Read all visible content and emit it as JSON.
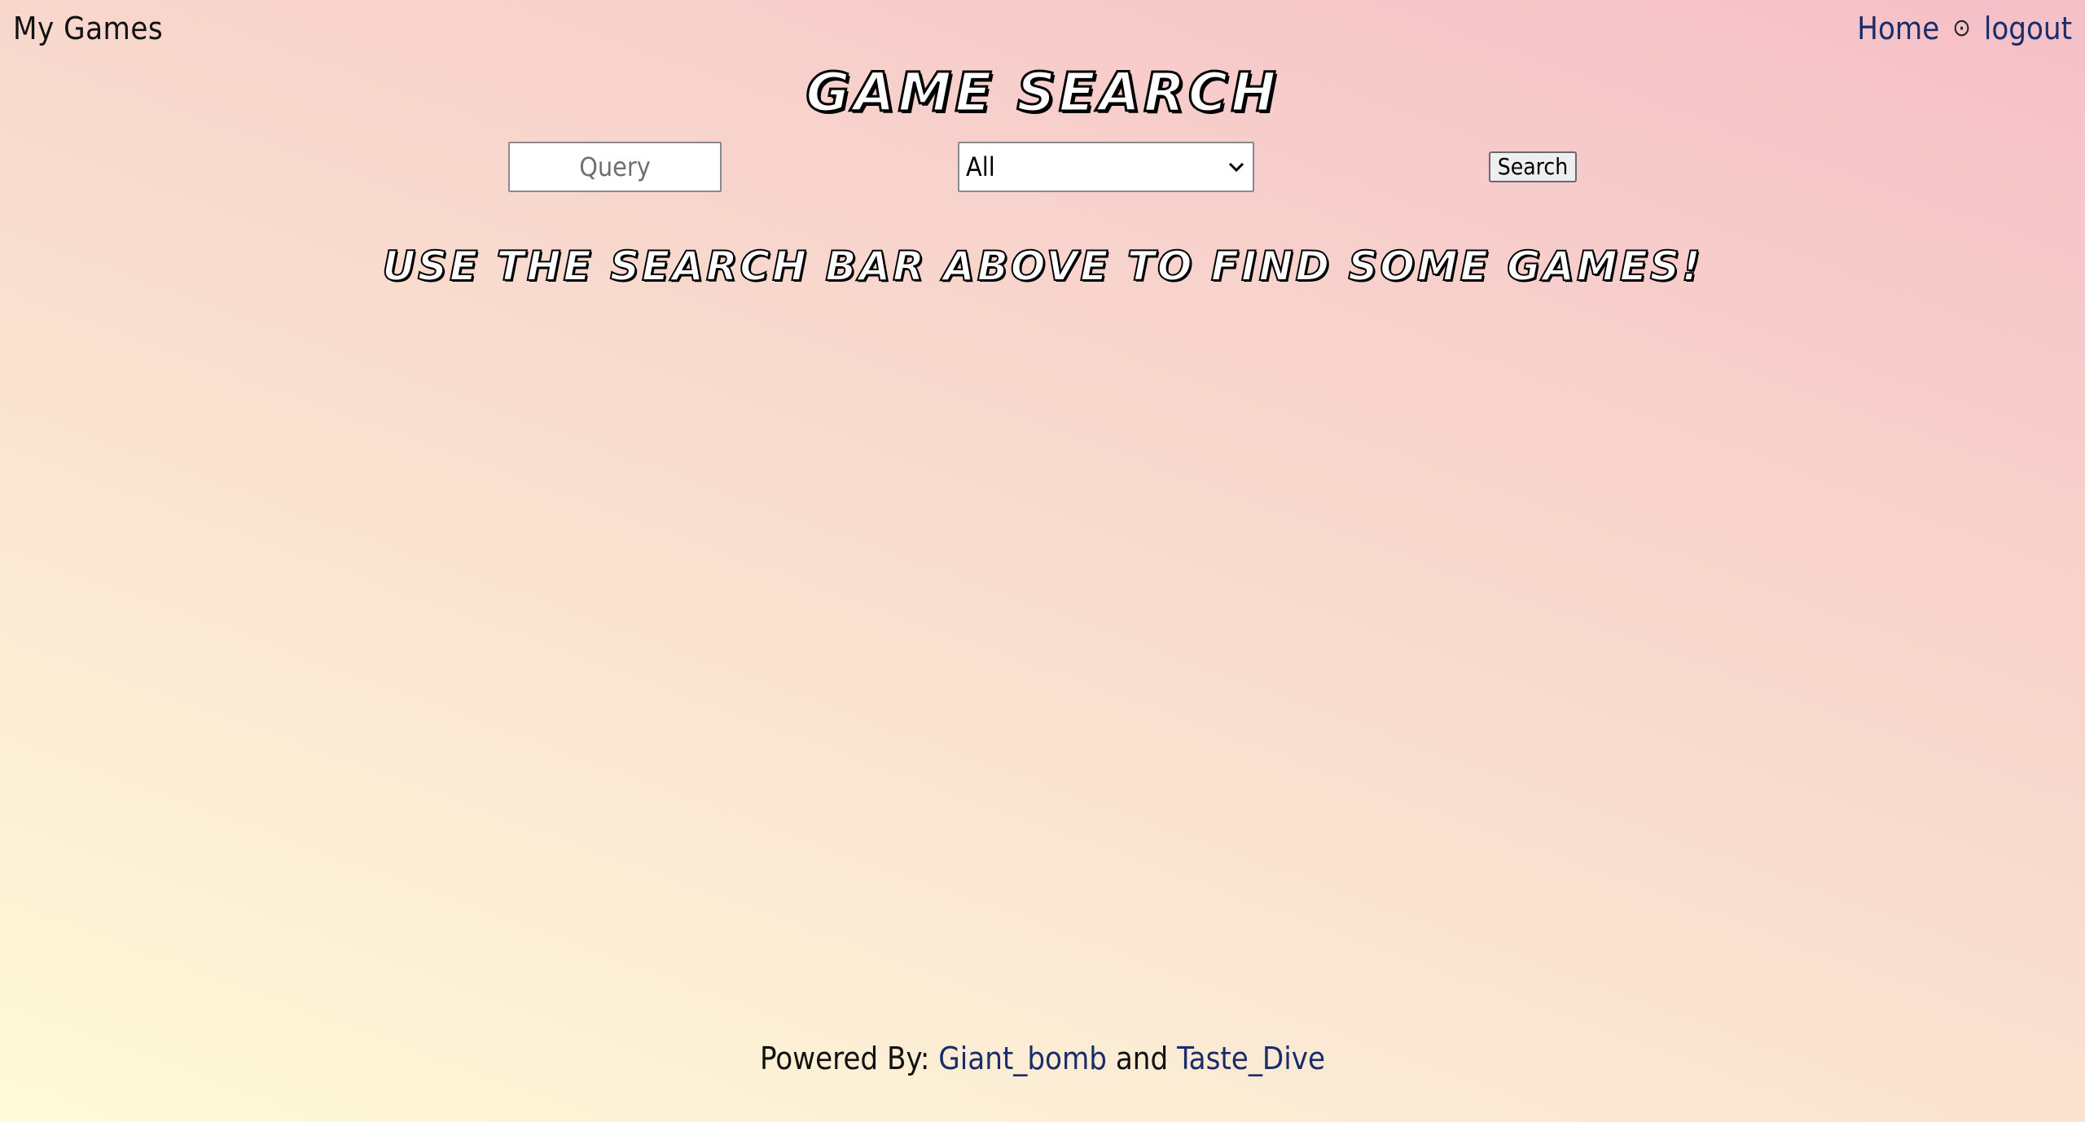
{
  "header": {
    "brand": "My Games",
    "nav": {
      "home": "Home",
      "separator": "⊙",
      "logout": "logout"
    }
  },
  "main": {
    "title": "GAME SEARCH",
    "search": {
      "query_value": "",
      "query_placeholder": "Query",
      "category_selected": "All",
      "button_label": "Search"
    },
    "hint": "USE THE SEARCH BAR ABOVE TO FIND SOME GAMES!"
  },
  "footer": {
    "powered_by": "Powered By:",
    "link1": "Giant_bomb",
    "and": "and",
    "link2": "Taste_Dive"
  },
  "colors": {
    "link": "#1a2d6b",
    "gradient_start": "#fffbd8",
    "gradient_end": "#f5bfc8"
  },
  "icons": {
    "select_chevron": "chevron-down-icon",
    "nav_separator": "circle-dot-icon"
  }
}
